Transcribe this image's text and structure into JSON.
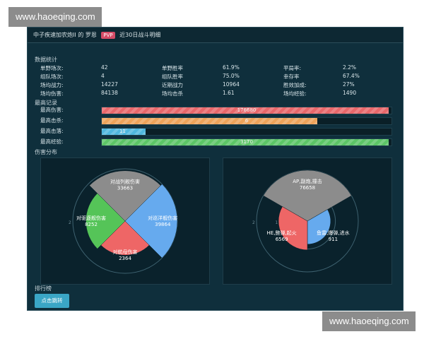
{
  "watermark": {
    "text": "www.haoeqing.com"
  },
  "header": {
    "player": "中子疾速加农炮II",
    "connector": "的",
    "hero": "罗恩",
    "mode": "PVP",
    "period": "近30日战斗明细"
  },
  "sections": {
    "stats": "数据统计",
    "records": "最高记录",
    "damage": "伤害分布",
    "ranking": "排行榜"
  },
  "stats": [
    [
      {
        "label": "单野场次:",
        "value": "42"
      },
      {
        "label": "单野胜率",
        "value": "61.9%"
      },
      {
        "label": "平局率:",
        "value": "2.2%"
      }
    ],
    [
      {
        "label": "组队场次:",
        "value": "4"
      },
      {
        "label": "组队胜率",
        "value": "75.0%"
      },
      {
        "label": "幸存率",
        "value": "67.4%"
      }
    ],
    [
      {
        "label": "场均战力:",
        "value": "14227"
      },
      {
        "label": "近期战力",
        "value": "10964"
      },
      {
        "label": "胜效加成:",
        "value": "27%"
      }
    ],
    [
      {
        "label": "场均伤害:",
        "value": "84138"
      },
      {
        "label": "场均击杀",
        "value": "1.61"
      },
      {
        "label": "场均经验:",
        "value": "1490"
      }
    ]
  ],
  "records": [
    {
      "label": "最高伤害:",
      "value": "176680",
      "fraction": 0.99,
      "color": "#e8676a"
    },
    {
      "label": "最高击杀:",
      "value": "6",
      "fraction": 0.745,
      "color": "#eea35a"
    },
    {
      "label": "最高击落:",
      "value": "11",
      "fraction": 0.15,
      "color": "#4fb7de"
    },
    {
      "label": "最高经验:",
      "value": "3170",
      "fraction": 0.99,
      "color": "#5cc566"
    }
  ],
  "chart_data": [
    {
      "type": "pie",
      "style": "rose",
      "slices": [
        {
          "name": "对战列舰伤害",
          "value": 33663,
          "color": "#8c8c8c"
        },
        {
          "name": "对巡洋舰伤害",
          "value": 39864,
          "color": "#66aaee"
        },
        {
          "name": "对航母伤害",
          "value": 2364,
          "color": "#ee6666"
        },
        {
          "name": "对驱逐舰伤害",
          "value": 8252,
          "color": "#55c458"
        }
      ],
      "ring_labels": [
        "1",
        "2"
      ]
    },
    {
      "type": "pie",
      "style": "rose",
      "slices": [
        {
          "name": "AP,副炮,撞击",
          "value": 76658,
          "color": "#8c8c8c"
        },
        {
          "name": "鱼雷,爆弹,进水",
          "value": 911,
          "color": "#66aaee"
        },
        {
          "name": "HE,鲍弹,起火",
          "value": 6569,
          "color": "#ee6666"
        }
      ],
      "ring_labels": [
        "1",
        "2"
      ]
    }
  ],
  "ranking": {
    "button_label": "点击跳转"
  }
}
